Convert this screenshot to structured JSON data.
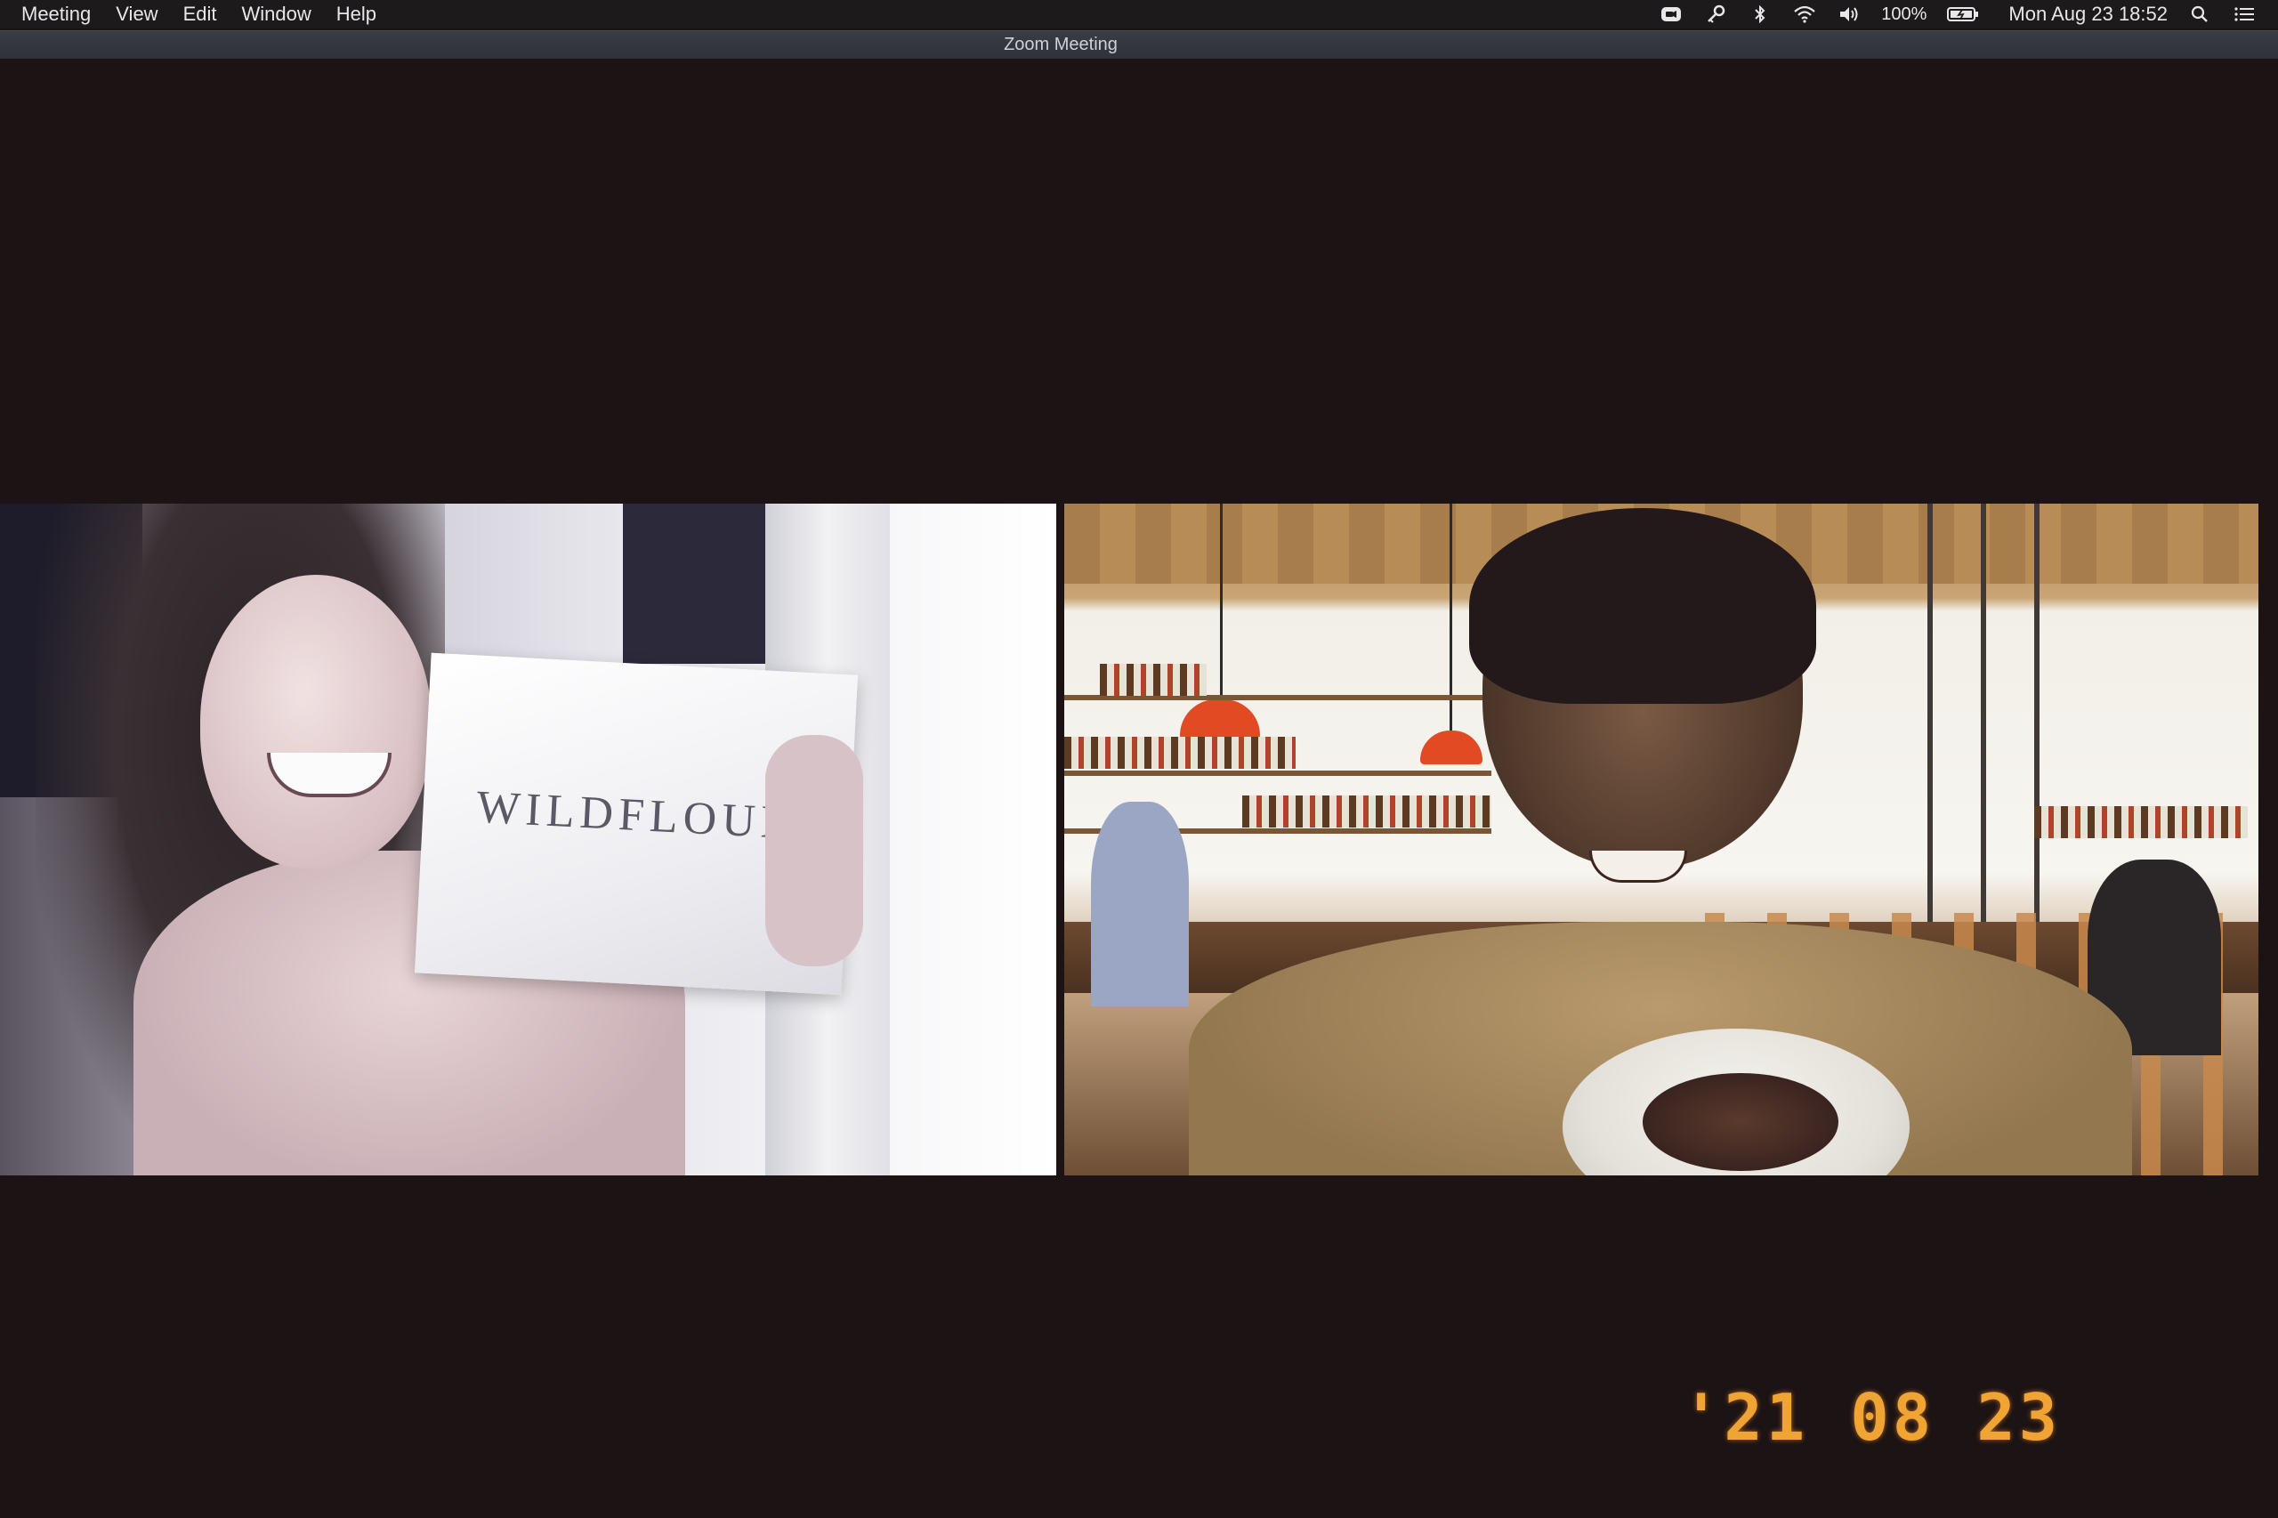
{
  "menubar": {
    "items": [
      "Meeting",
      "View",
      "Edit",
      "Window",
      "Help"
    ],
    "battery_percent": "100%",
    "clock": "Mon Aug 23  18:52",
    "icons": [
      "zoom-icon",
      "key-icon",
      "bluetooth-icon",
      "wifi-icon",
      "volume-icon",
      "battery-icon",
      "search-icon",
      "notification-center-icon"
    ]
  },
  "window": {
    "title": "Zoom Meeting"
  },
  "participants": [
    {
      "tile": "left",
      "held_item_text": "WILDFLOUR"
    },
    {
      "tile": "right"
    }
  ],
  "datestamp": "'21 08 23",
  "colors": {
    "menubar_bg": "#1d1a1c",
    "canvas_bg": "#1c1314",
    "datestamp": "#f0a433"
  }
}
